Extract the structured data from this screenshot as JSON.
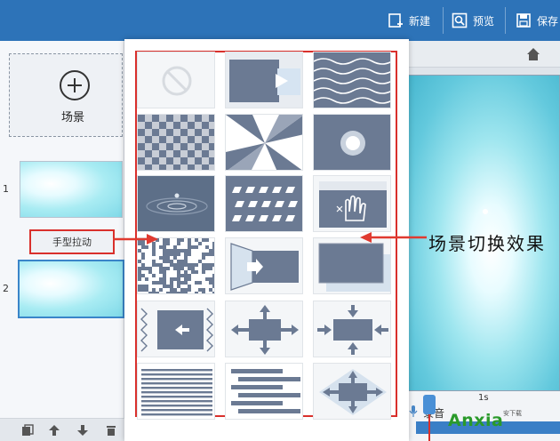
{
  "toolbar": {
    "new_label": "新建",
    "preview_label": "预览",
    "save_label": "保存"
  },
  "left_panel": {
    "add_scene_label": "场景",
    "scenes": [
      {
        "number": "1"
      },
      {
        "number": "2"
      }
    ],
    "selected_transition_label": "手型拉动"
  },
  "transitions": [
    {
      "icon": "none-icon"
    },
    {
      "icon": "push-right-icon"
    },
    {
      "icon": "wave-icon"
    },
    {
      "icon": "checkerboard-icon"
    },
    {
      "icon": "pinwheel-icon"
    },
    {
      "icon": "circle-reveal-icon"
    },
    {
      "icon": "ripple-icon"
    },
    {
      "icon": "dots-grid-icon"
    },
    {
      "icon": "hand-drag-icon"
    },
    {
      "icon": "dissolve-icon"
    },
    {
      "icon": "door-push-icon"
    },
    {
      "icon": "overlap-slide-icon"
    },
    {
      "icon": "zigzag-push-left-icon"
    },
    {
      "icon": "expand-arrows-icon"
    },
    {
      "icon": "contract-arrows-icon"
    },
    {
      "icon": "horizontal-lines-icon"
    },
    {
      "icon": "interlaced-bars-icon"
    },
    {
      "icon": "diamond-expand-icon"
    }
  ],
  "right_panel": {
    "audio_label": "录音",
    "timeline_tick": "1s"
  },
  "annotation": {
    "callout": "场景切换效果"
  },
  "watermark": {
    "brand": "Anxia",
    "sub": "安下载"
  },
  "colors": {
    "topbar": "#2d73b8",
    "highlight_red": "#d9302c",
    "tile": "#6b7a93"
  }
}
